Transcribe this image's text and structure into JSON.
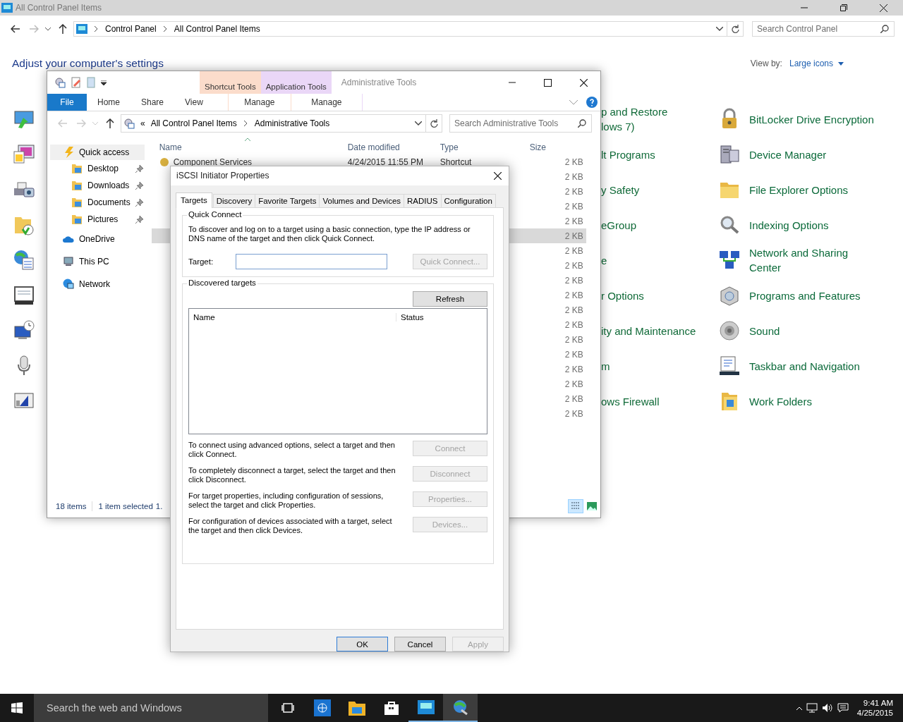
{
  "control_panel": {
    "title": "All Control Panel Items",
    "breadcrumb": [
      "Control Panel",
      "All Control Panel Items"
    ],
    "search": {
      "placeholder": "Search Control Panel"
    },
    "heading": "Adjust your computer's settings",
    "view_by_label": "View by:",
    "view_by_value": "Large icons",
    "middle_items": [
      {
        "label": "p and Restore\nlows 7)"
      },
      {
        "label": "lt Programs"
      },
      {
        "label": "y Safety"
      },
      {
        "label": "eGroup"
      },
      {
        "label": "e"
      },
      {
        "label": "r Options"
      },
      {
        "label": "ity and Maintenance"
      },
      {
        "label": "m"
      },
      {
        "label": "ows Firewall"
      }
    ],
    "right_items": [
      {
        "label": "BitLocker Drive Encryption"
      },
      {
        "label": "Device Manager"
      },
      {
        "label": "File Explorer Options"
      },
      {
        "label": "Indexing Options"
      },
      {
        "label": "Network and Sharing\nCenter"
      },
      {
        "label": "Programs and Features"
      },
      {
        "label": "Sound"
      },
      {
        "label": "Taskbar and Navigation"
      },
      {
        "label": "Work Folders"
      }
    ]
  },
  "explorer": {
    "title": "Administrative Tools",
    "context_tabs": [
      {
        "group": "Shortcut Tools",
        "tab": "Manage",
        "color": "#fbdccb"
      },
      {
        "group": "Application Tools",
        "tab": "Manage",
        "color": "#ead7f7"
      }
    ],
    "file_tab": "File",
    "ribbon_tabs": [
      "Home",
      "Share",
      "View"
    ],
    "address": {
      "overflow": "«",
      "breadcrumb": [
        "All Control Panel Items",
        "Administrative Tools"
      ]
    },
    "search": {
      "placeholder": "Search Administrative Tools"
    },
    "nav": [
      {
        "label": "Quick access",
        "selected": true,
        "children": [
          {
            "label": "Desktop",
            "pinned": true
          },
          {
            "label": "Downloads",
            "pinned": true
          },
          {
            "label": "Documents",
            "pinned": true
          },
          {
            "label": "Pictures",
            "pinned": true
          }
        ]
      },
      {
        "label": "OneDrive",
        "selected": false
      },
      {
        "label": "This PC",
        "selected": false
      },
      {
        "label": "Network",
        "selected": false
      }
    ],
    "columns": [
      "Name",
      "Date modified",
      "Type",
      "Size"
    ],
    "rows": [
      {
        "name": "Component Services",
        "date": "4/24/2015 11:55 PM",
        "type": "Shortcut",
        "size": "2 KB",
        "selected": false
      },
      {
        "size": "2 KB",
        "selected": false
      },
      {
        "size": "2 KB",
        "selected": false
      },
      {
        "size": "2 KB",
        "selected": false
      },
      {
        "size": "2 KB",
        "selected": false
      },
      {
        "size": "2 KB",
        "selected": true
      },
      {
        "size": "2 KB",
        "selected": false
      },
      {
        "size": "2 KB",
        "selected": false
      },
      {
        "size": "2 KB",
        "selected": false
      },
      {
        "size": "2 KB",
        "selected": false
      },
      {
        "size": "2 KB",
        "selected": false
      },
      {
        "size": "2 KB",
        "selected": false
      },
      {
        "size": "2 KB",
        "selected": false
      },
      {
        "size": "2 KB",
        "selected": false
      },
      {
        "size": "2 KB",
        "selected": false
      },
      {
        "size": "2 KB",
        "selected": false
      },
      {
        "size": "2 KB",
        "selected": false
      },
      {
        "size": "2 KB",
        "selected": false
      }
    ],
    "status": {
      "count": "18 items",
      "selection": "1 item selected",
      "selection_size": "1."
    }
  },
  "dialog": {
    "title": "iSCSI Initiator Properties",
    "tabs": [
      {
        "label": "Targets",
        "selected": true
      },
      {
        "label": "Discovery",
        "selected": false
      },
      {
        "label": "Favorite Targets",
        "selected": false
      },
      {
        "label": "Volumes and Devices",
        "selected": false
      },
      {
        "label": "RADIUS",
        "selected": false
      },
      {
        "label": "Configuration",
        "selected": false
      }
    ],
    "quick_connect": {
      "legend": "Quick Connect",
      "description": "To discover and log on to a target using a basic connection, type the IP address or DNS name of the target and then click Quick Connect.",
      "target_label": "Target:",
      "button": {
        "label": "Quick Connect...",
        "disabled": true
      }
    },
    "discovered": {
      "legend": "Discovered targets",
      "refresh": {
        "label": "Refresh",
        "disabled": false
      },
      "columns": [
        "Name",
        "Status"
      ],
      "actions": [
        {
          "description": "To connect using advanced options, select a target and then click Connect.",
          "button": {
            "label": "Connect",
            "disabled": true
          }
        },
        {
          "description": "To completely disconnect a target, select the target and then click Disconnect.",
          "button": {
            "label": "Disconnect",
            "disabled": true
          }
        },
        {
          "description": "For target properties, including configuration of sessions, select the target and click Properties.",
          "button": {
            "label": "Properties...",
            "disabled": true
          }
        },
        {
          "description": "For configuration of devices associated with a target, select the target and then click Devices.",
          "button": {
            "label": "Devices...",
            "disabled": true
          }
        }
      ]
    },
    "buttons": [
      {
        "label": "OK",
        "disabled": false,
        "default": true
      },
      {
        "label": "Cancel",
        "disabled": false,
        "default": false
      },
      {
        "label": "Apply",
        "disabled": true,
        "default": false
      }
    ]
  },
  "taskbar": {
    "search": {
      "placeholder": "Search the web and Windows"
    },
    "time": "9:41 AM",
    "date": "4/25/2015"
  }
}
